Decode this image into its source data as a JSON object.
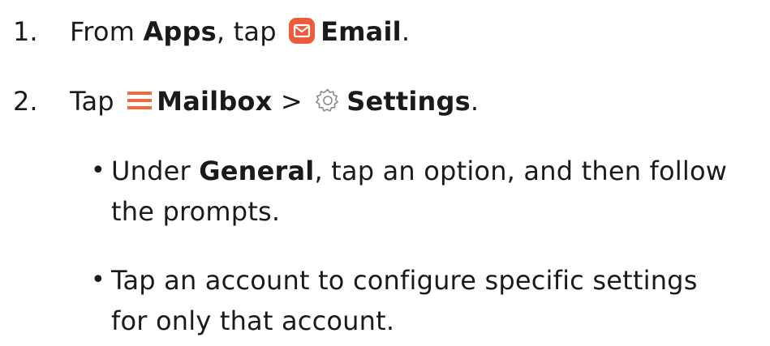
{
  "steps": [
    {
      "number": "1.",
      "prefix": "From ",
      "apps_bold": "Apps",
      "middle": ", tap ",
      "icon": "email-app-icon",
      "email_bold": "Email",
      "suffix": "."
    },
    {
      "number": "2.",
      "prefix": "Tap ",
      "icon1": "menu-icon",
      "mailbox_bold": "Mailbox",
      "separator": " > ",
      "icon2": "gear-icon",
      "settings_bold": "Settings",
      "suffix": "."
    }
  ],
  "bullets": [
    {
      "marker": "•",
      "prefix": "Under ",
      "general_bold": "General",
      "rest_line1": ", tap an option, and then follow",
      "line2": "the prompts."
    },
    {
      "marker": "•",
      "line1": "Tap an account to configure specific settings",
      "line2": "for only that account."
    }
  ],
  "colors": {
    "text": "#1a1a1a",
    "accent": "#ef6c3a",
    "gear": "#8a8a8a"
  }
}
